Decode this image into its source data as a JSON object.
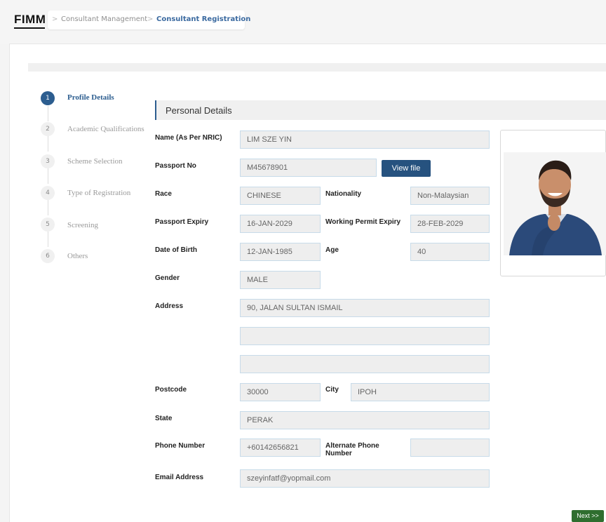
{
  "brand": {
    "logo_text": "FIMM"
  },
  "breadcrumb": {
    "sep": ">",
    "items": [
      "Consultant Management",
      "Consultant Registration"
    ]
  },
  "stepper": {
    "steps": [
      {
        "num": "1",
        "label": "Profile Details"
      },
      {
        "num": "2",
        "label": "Academic Qualifications"
      },
      {
        "num": "3",
        "label": "Scheme Selection"
      },
      {
        "num": "4",
        "label": "Type of Registration"
      },
      {
        "num": "5",
        "label": "Screening"
      },
      {
        "num": "6",
        "label": "Others"
      }
    ],
    "active_step": 1
  },
  "section": {
    "title": "Personal Details"
  },
  "form": {
    "name": {
      "label": "Name (As Per NRIC)",
      "value": "LIM SZE YIN"
    },
    "passport_no": {
      "label": "Passport No",
      "value": "M45678901"
    },
    "view_file_label": "View file",
    "race": {
      "label": "Race",
      "value": "CHINESE"
    },
    "nationality": {
      "label": "Nationality",
      "value": "Non-Malaysian"
    },
    "passport_expiry": {
      "label": "Passport Expiry",
      "value": "16-JAN-2029"
    },
    "working_permit_expiry": {
      "label": "Working Permit Expiry",
      "value": "28-FEB-2029"
    },
    "dob": {
      "label": "Date of Birth",
      "value": "12-JAN-1985"
    },
    "age": {
      "label": "Age",
      "value": "40"
    },
    "gender": {
      "label": "Gender",
      "value": "MALE"
    },
    "address": {
      "label": "Address",
      "line1": "90, JALAN SULTAN ISMAIL",
      "line2": "",
      "line3": ""
    },
    "postcode": {
      "label": "Postcode",
      "value": "30000"
    },
    "city": {
      "label": "City",
      "value": "IPOH"
    },
    "state": {
      "label": "State",
      "value": "PERAK"
    },
    "phone": {
      "label": "Phone Number",
      "value": "+60142656821"
    },
    "alt_phone": {
      "label_line1": "Alternate Phone",
      "label_line2": "Number",
      "value": ""
    },
    "email": {
      "label": "Email Address",
      "value": "szeyinfatf@yopmail.com"
    }
  },
  "next_label": "Next >>",
  "colors": {
    "primary": "#2c5d8f",
    "next_button": "#2f6e2f",
    "field_bg": "#eeeeee",
    "field_border": "#c7dbe9"
  },
  "icons": {
    "profile_photo": "person-photo"
  }
}
